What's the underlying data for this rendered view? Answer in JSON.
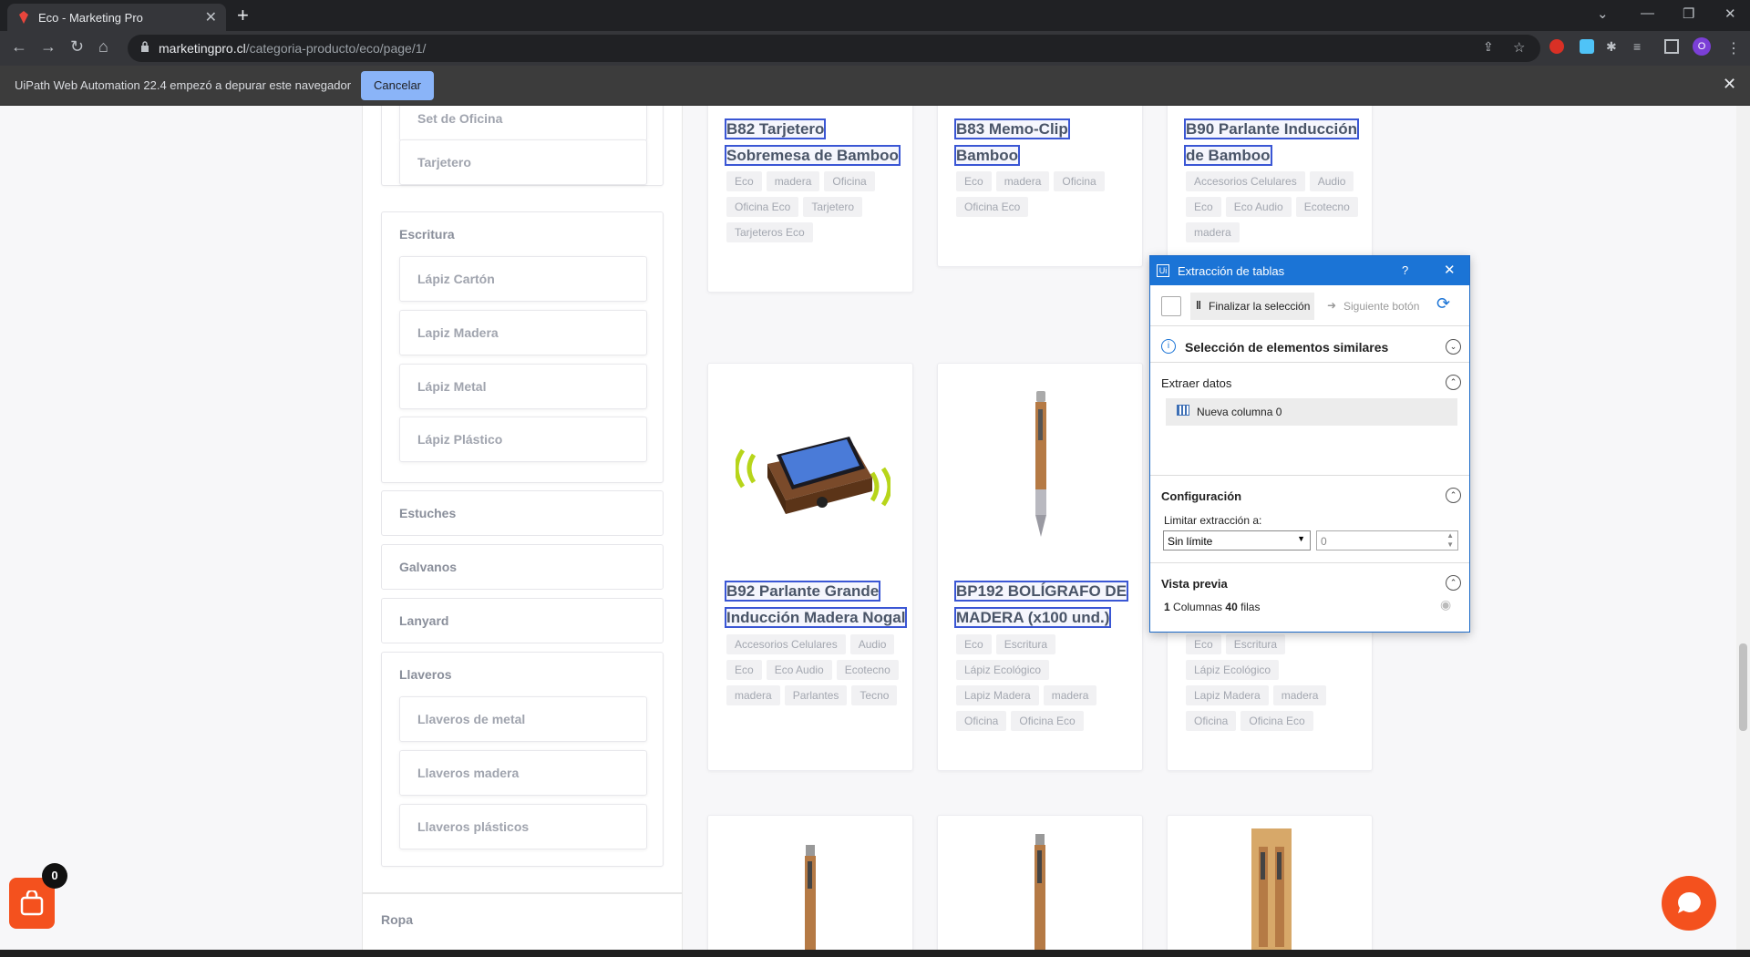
{
  "browser": {
    "tab_title": "Eco - Marketing Pro",
    "url_host": "marketingpro.cl",
    "url_path": "/categoria-producto/eco/page/1/",
    "profile_initial": "O"
  },
  "infobar": {
    "message": "UiPath Web Automation 22.4 empezó a depurar este navegador",
    "cancel_label": "Cancelar"
  },
  "sidebar": {
    "oficina_items": [
      "Set de Oficina",
      "Tarjetero"
    ],
    "escritura_title": "Escritura",
    "escritura_items": [
      "Lápiz Cartón",
      "Lapiz Madera",
      "Lápiz Metal",
      "Lápiz Plástico"
    ],
    "categories": [
      "Estuches",
      "Galvanos",
      "Lanyard"
    ],
    "llaveros_title": "Llaveros",
    "llaveros_items": [
      "Llaveros de metal",
      "Llaveros madera",
      "Llaveros plásticos"
    ],
    "ropa_title": "Ropa"
  },
  "products": [
    {
      "title_lines": [
        "B82 Tarjetero",
        "Sobremesa de Bamboo"
      ],
      "tags": [
        "Eco",
        "madera",
        "Oficina",
        "Oficina Eco",
        "Tarjetero",
        "Tarjeteros Eco"
      ]
    },
    {
      "title_lines": [
        "B83 Memo-Clip",
        "Bamboo"
      ],
      "tags": [
        "Eco",
        "madera",
        "Oficina",
        "Oficina Eco"
      ]
    },
    {
      "title_lines": [
        "B90 Parlante Inducción",
        "de Bamboo"
      ],
      "tags": [
        "Accesorios Celulares",
        "Audio",
        "Eco",
        "Eco Audio",
        "Ecotecno",
        "madera"
      ]
    },
    {
      "title_lines": [
        "B92 Parlante Grande",
        "Inducción Madera Nogal"
      ],
      "tags": [
        "Accesorios Celulares",
        "Audio",
        "Eco",
        "Eco Audio",
        "Ecotecno",
        "madera",
        "Parlantes",
        "Tecno"
      ]
    },
    {
      "title_lines": [
        "BP192 BOLÍGRAFO DE",
        "MADERA (x100 und.)"
      ],
      "tags": [
        "Eco",
        "Escritura",
        "Lápiz Ecológico",
        "Lapiz Madera",
        "madera",
        "Oficina",
        "Oficina Eco"
      ]
    },
    {
      "title_lines": [
        "",
        ""
      ],
      "tags": [
        "Eco",
        "Escritura",
        "Lápiz Ecológico",
        "Lapiz Madera",
        "madera",
        "Oficina",
        "Oficina Eco"
      ]
    }
  ],
  "uipath": {
    "title": "Extracción de tablas",
    "help": "?",
    "finish_label": "Finalizar la selección",
    "next_label": "Siguiente botón",
    "similar_label": "Selección de elementos similares",
    "extract_label": "Extraer datos",
    "column_label": "Nueva columna 0",
    "config_label": "Configuración",
    "limit_label": "Limitar extracción a:",
    "limit_value": "Sin límite",
    "limit_number": "0",
    "preview_label": "Vista previa",
    "preview_cols": "1",
    "preview_cols_text": "Columnas",
    "preview_rows": "40",
    "preview_rows_text": "filas"
  },
  "cart": {
    "count": "0"
  },
  "colors": {
    "accent": "#1b74d6",
    "chat": "#f4511e",
    "highlight": "#3a56d4"
  }
}
